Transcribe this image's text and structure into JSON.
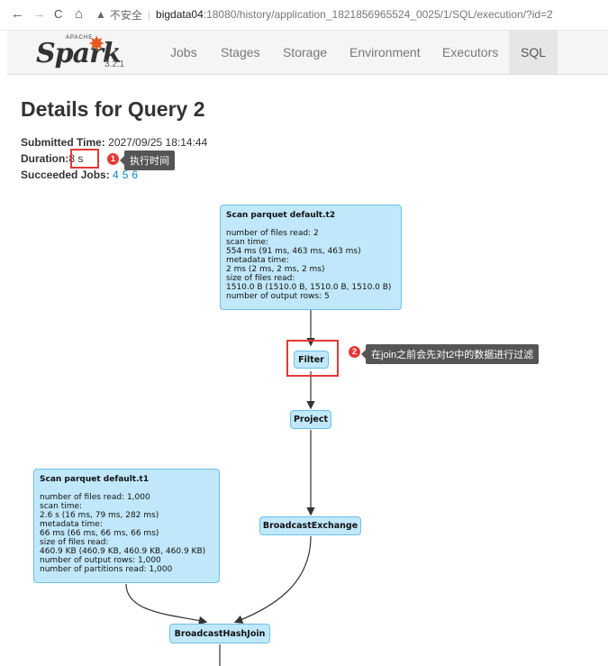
{
  "browser": {
    "back": "←",
    "forward": "→",
    "reload": "C",
    "home": "⌂",
    "insecure_label": "不安全",
    "url_host": "bigdata04",
    "url_rest": ":18080/history/application_1821856965524_0025/1/SQL/execution/?id=2"
  },
  "navbar": {
    "logo_apache": "APACHE",
    "logo_text": "Spark",
    "version": "3.2.1",
    "tabs": [
      {
        "label": "Jobs"
      },
      {
        "label": "Stages"
      },
      {
        "label": "Storage"
      },
      {
        "label": "Environment"
      },
      {
        "label": "Executors"
      },
      {
        "label": "SQL",
        "active": true
      }
    ]
  },
  "page": {
    "title": "Details for Query 2",
    "submitted_label": "Submitted Time:",
    "submitted_value": "2027/09/25 18:14:44",
    "duration_label": "Duration:",
    "duration_value": "8 s",
    "jobs_label": "Succeeded Jobs:",
    "jobs": [
      "4",
      "5",
      "6"
    ]
  },
  "annotations": [
    {
      "number": "1",
      "text": "执行时间"
    },
    {
      "number": "2",
      "text": "在join之前会先对t2中的数据进行过滤"
    }
  ],
  "plan": {
    "scan_t2": {
      "title": "Scan parquet default.t2",
      "lines": [
        "number of files read: 2",
        "scan time:",
        "554 ms (91 ms, 463 ms, 463 ms)",
        "metadata time:",
        "2 ms (2 ms, 2 ms, 2 ms)",
        "size of files read:",
        "1510.0 B (1510.0 B, 1510.0 B, 1510.0 B)",
        "number of output rows: 5"
      ]
    },
    "filter": "Filter",
    "project": "Project",
    "broadcast_exchange": "BroadcastExchange",
    "scan_t1": {
      "title": "Scan parquet default.t1",
      "lines": [
        "number of files read: 1,000",
        "scan time:",
        "2.6 s (16 ms, 79 ms, 282 ms)",
        "metadata time:",
        "66 ms (66 ms, 66 ms, 66 ms)",
        "size of files read:",
        "460.9 KB (460.9 KB, 460.9 KB, 460.9 KB)",
        "number of output rows: 1,000",
        "number of partitions read: 1,000"
      ]
    },
    "broadcast_hash_join": "BroadcastHashJoin"
  }
}
